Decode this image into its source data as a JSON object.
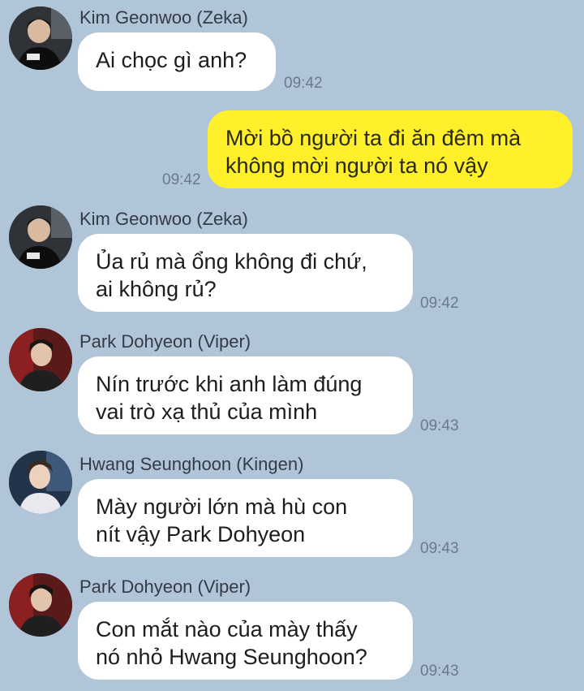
{
  "messages": [
    {
      "sender": "Kim Geonwoo (Zeka)",
      "text": "Ai chọc gì anh?",
      "time": "09:42",
      "avatar": "avatar-zeka"
    },
    {
      "sender": "",
      "text": "Mời bồ người ta đi ăn đêm mà\nkhông mời người ta nó vậy",
      "time": "09:42",
      "outgoing": true
    },
    {
      "sender": "Kim Geonwoo (Zeka)",
      "text": "Ủa rủ mà ổng không đi chứ,\nai không rủ?",
      "time": "09:42",
      "avatar": "avatar-zeka"
    },
    {
      "sender": "Park Dohyeon (Viper)",
      "text": "Nín trước khi anh làm đúng\nvai trò xạ thủ của mình",
      "time": "09:43",
      "avatar": "avatar-viper"
    },
    {
      "sender": "Hwang Seunghoon (Kingen)",
      "text": "Mày người lớn mà hù con\nnít vậy Park Dohyeon",
      "time": "09:43",
      "avatar": "avatar-kingen"
    },
    {
      "sender": "Park Dohyeon (Viper)",
      "text": "Con mắt nào của mày thấy\nnó nhỏ Hwang Seunghoon?",
      "time": "09:43",
      "avatar": "avatar-viper"
    }
  ],
  "colors": {
    "background": "#b1c5d9",
    "incoming_bubble": "#ffffff",
    "outgoing_bubble": "#fff02b"
  }
}
